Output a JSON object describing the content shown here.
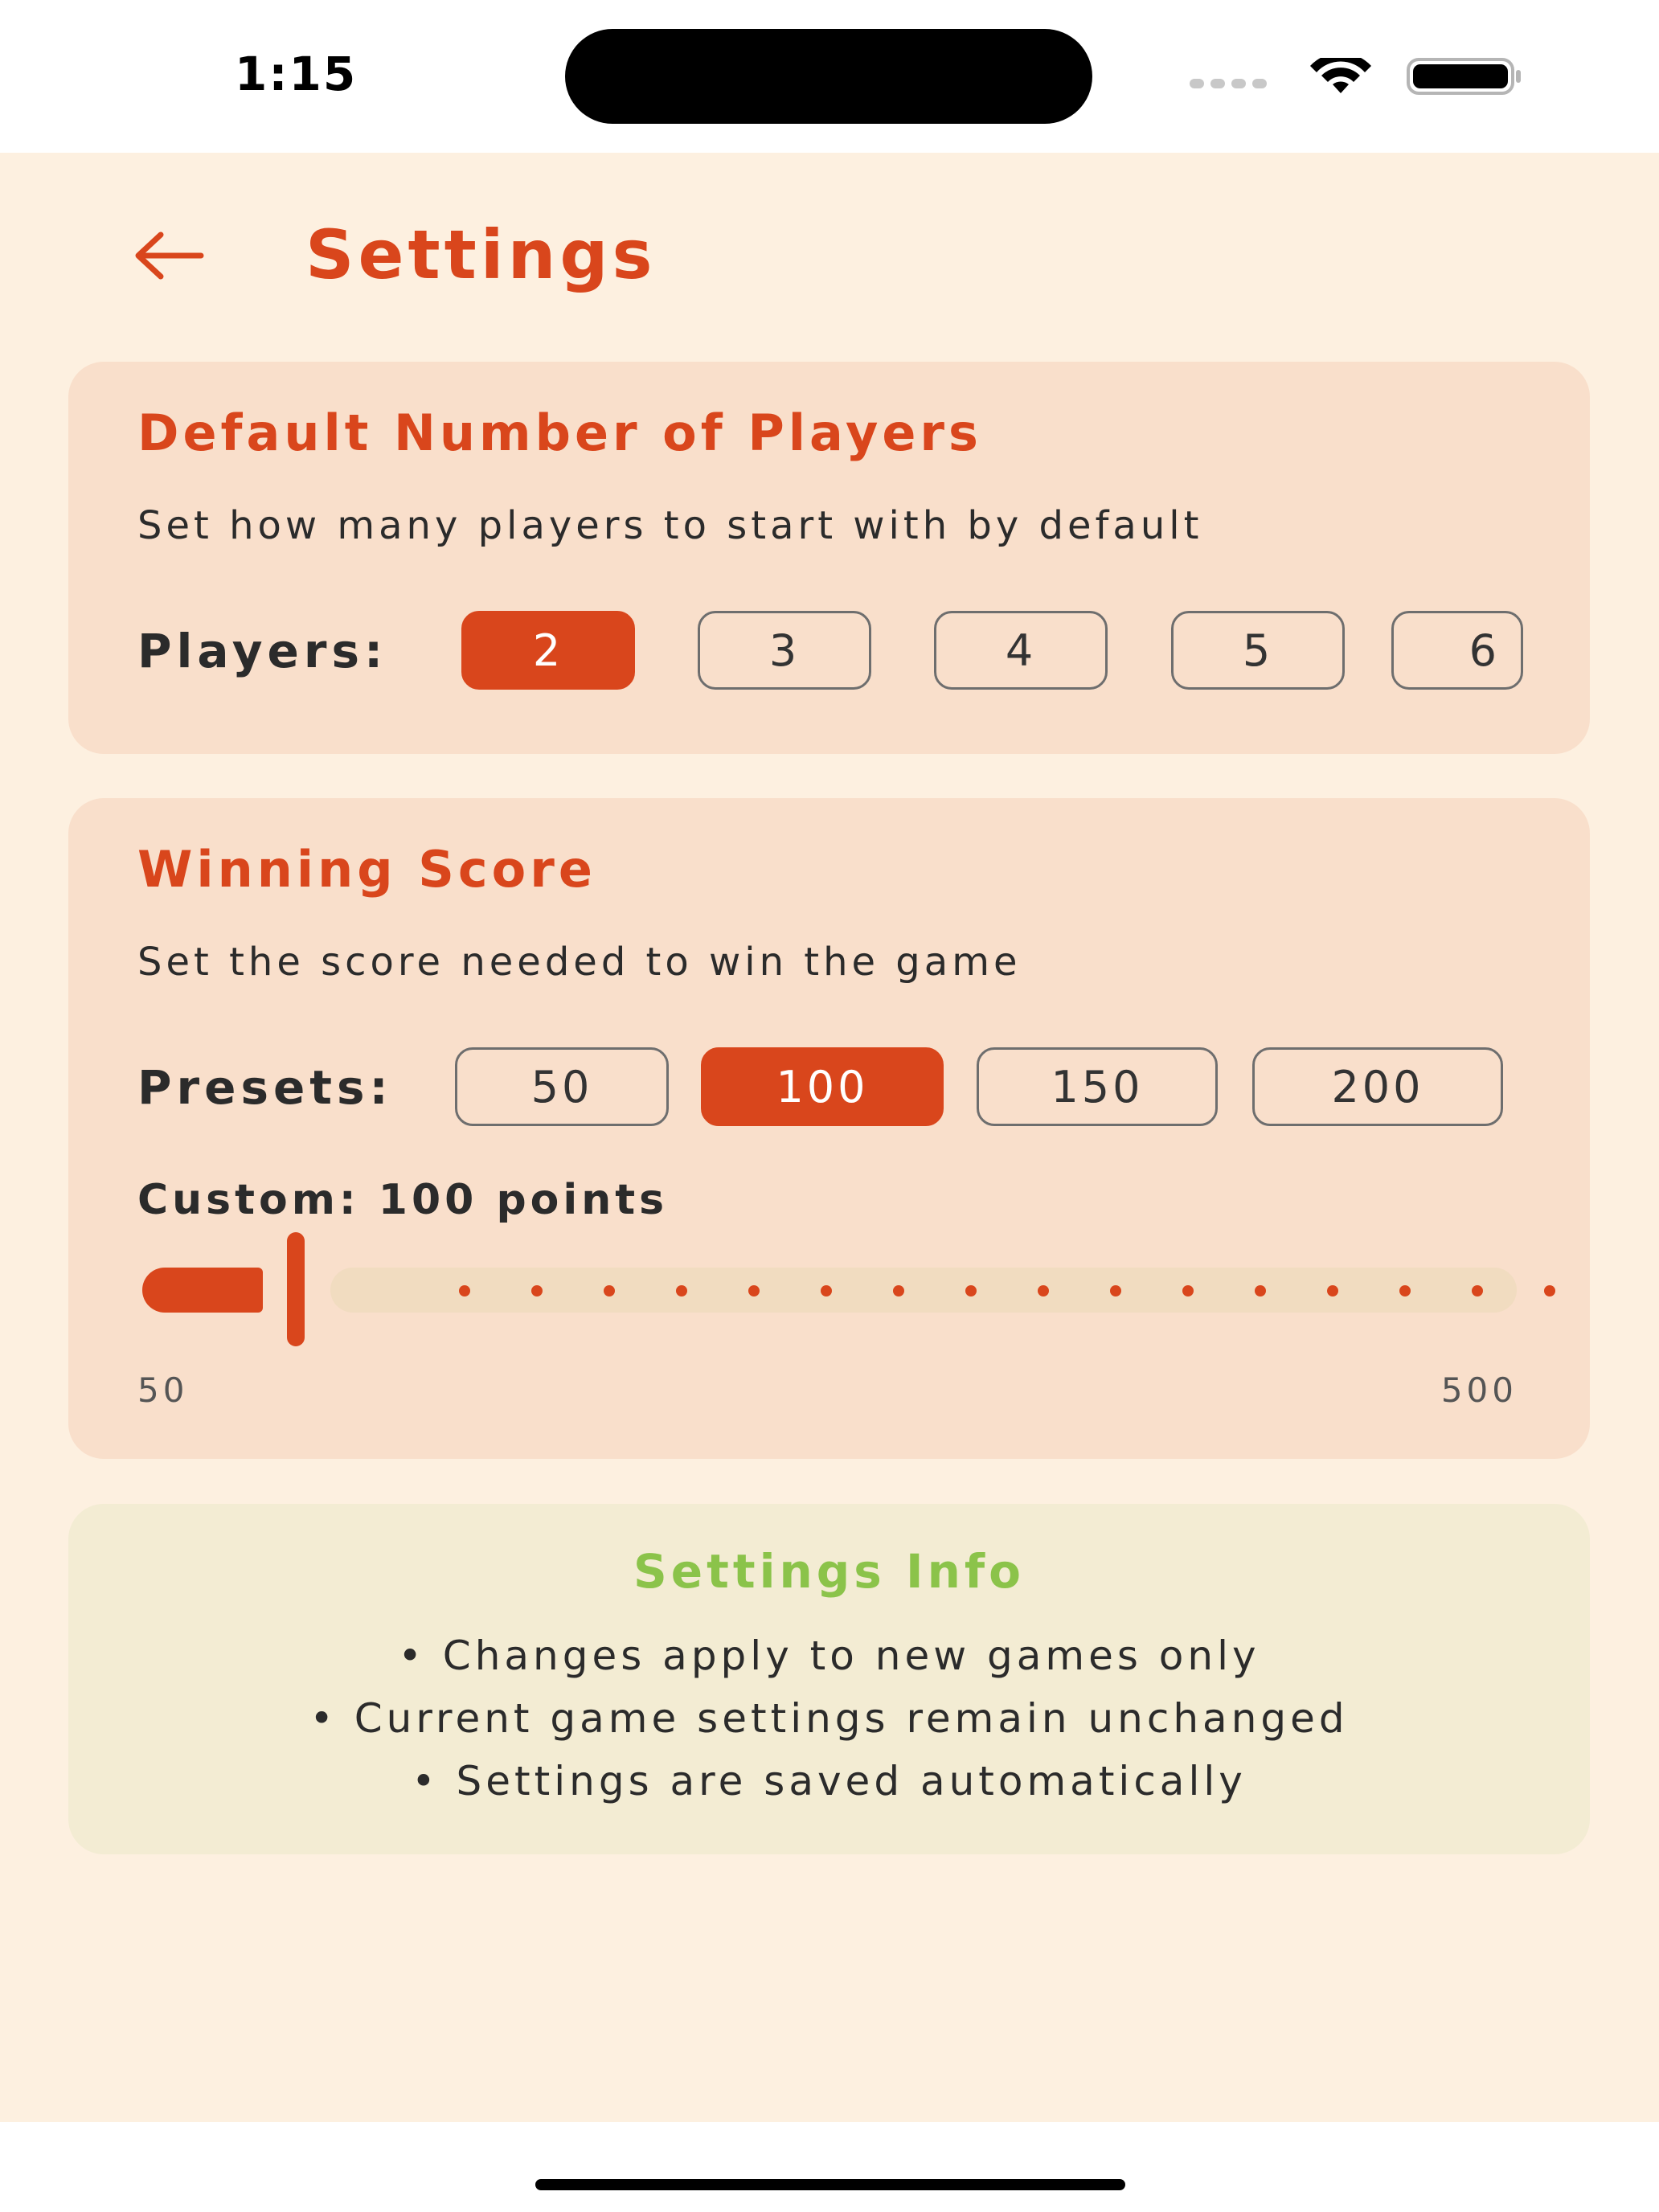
{
  "status_bar": {
    "time": "1:15"
  },
  "header": {
    "title": "Settings",
    "back_icon": "arrow-left-icon"
  },
  "players_card": {
    "title": "Default Number of Players",
    "description": "Set how many players to start with by default",
    "label": "Players:",
    "options": [
      "2",
      "3",
      "4",
      "5",
      "6"
    ],
    "selected": "2"
  },
  "score_card": {
    "title": "Winning Score",
    "description": "Set the score needed to win the game",
    "presets_label": "Presets:",
    "presets": [
      "50",
      "100",
      "150",
      "200"
    ],
    "selected": "100",
    "custom_label": "Custom: 100 points",
    "slider": {
      "min": 50,
      "max": 500,
      "value": 100,
      "min_label": "50",
      "max_label": "500"
    }
  },
  "info_card": {
    "title": "Settings Info",
    "lines": [
      "• Changes apply to new games only",
      "• Current game settings remain unchanged",
      "• Settings are saved automatically"
    ]
  },
  "colors": {
    "accent": "#d9461c",
    "background": "#fdf0e0",
    "card": "#f9dfcb",
    "info_card": "#f3ecd3",
    "info_title": "#8bc34a"
  }
}
